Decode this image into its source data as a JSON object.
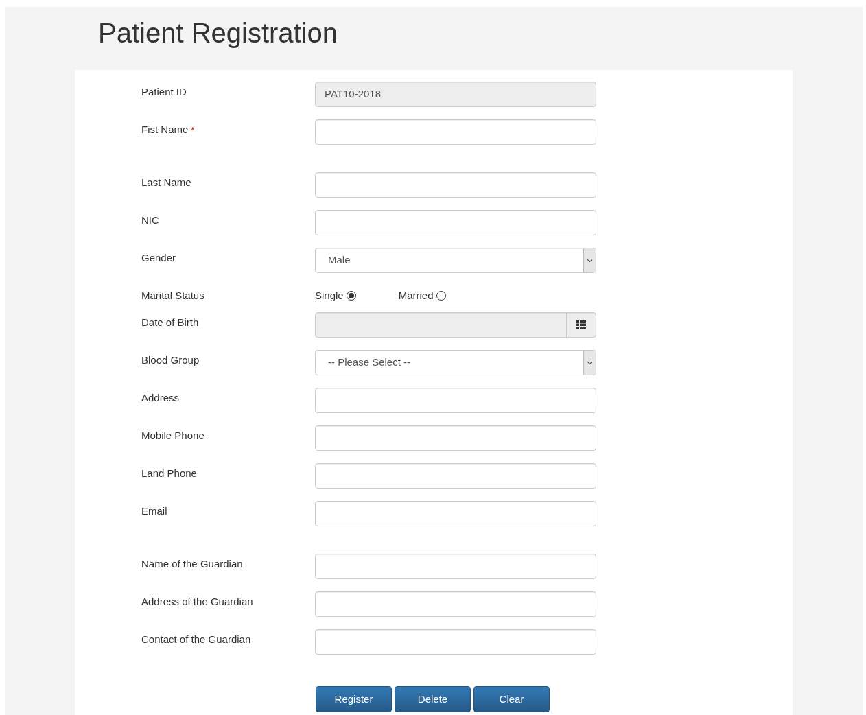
{
  "title": "Patient Registration",
  "sections": [
    {
      "fields": [
        {
          "label": "Patient ID",
          "kind": "readonly",
          "value": "PAT10-2018"
        },
        {
          "label": "Fist Name",
          "kind": "text",
          "required_mark": "*"
        }
      ]
    },
    {
      "fields": [
        {
          "label": "Last Name",
          "kind": "text"
        },
        {
          "label": "NIC",
          "kind": "text"
        },
        {
          "label": "Gender",
          "kind": "select",
          "value": "Male"
        },
        {
          "label": "Marital Status",
          "kind": "radio",
          "options": [
            {
              "label": "Single",
              "selected": true
            },
            {
              "label": "Married",
              "selected": false
            }
          ]
        },
        {
          "label": "Date of Birth",
          "kind": "date"
        },
        {
          "label": "Blood Group",
          "kind": "select",
          "value": "-- Please Select --"
        },
        {
          "label": "Address",
          "kind": "text"
        },
        {
          "label": "Mobile Phone",
          "kind": "text"
        },
        {
          "label": "Land Phone",
          "kind": "text"
        },
        {
          "label": "Email",
          "kind": "text"
        }
      ]
    },
    {
      "fields": [
        {
          "label": "Name of the Guardian",
          "kind": "text"
        },
        {
          "label": "Address of the Guardian",
          "kind": "text"
        },
        {
          "label": "Contact of the Guardian",
          "kind": "text"
        }
      ]
    }
  ],
  "buttons": [
    "Register",
    "Delete",
    "Clear"
  ]
}
